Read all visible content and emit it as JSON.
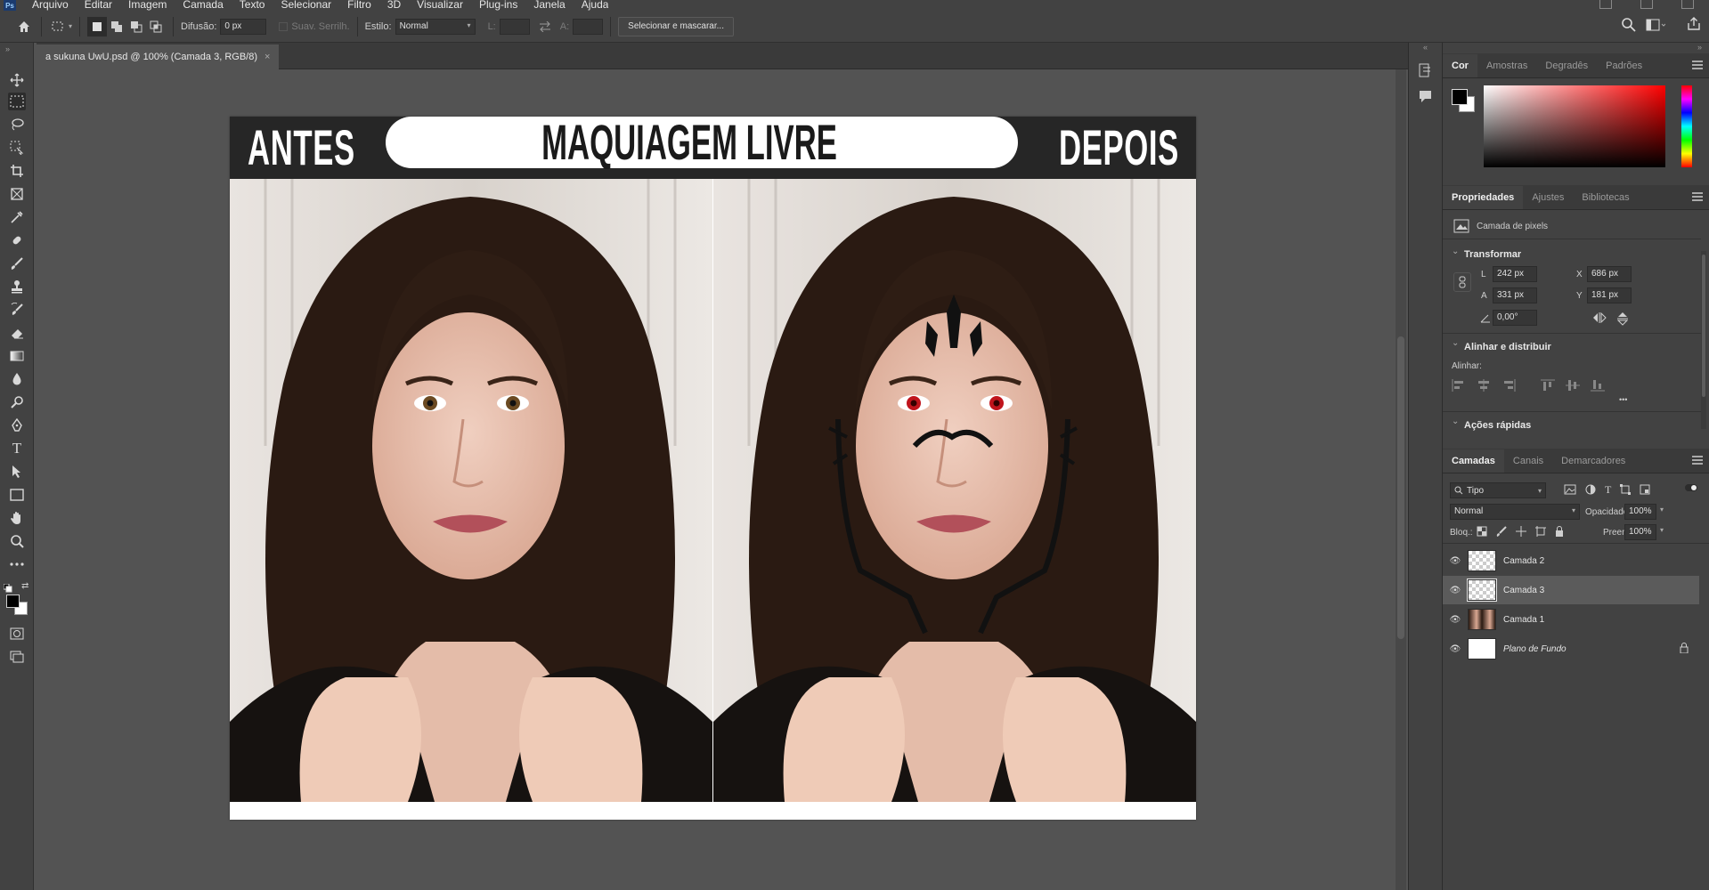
{
  "app": {
    "logo_text": "Ps"
  },
  "menu": [
    "Arquivo",
    "Editar",
    "Imagem",
    "Camada",
    "Texto",
    "Selecionar",
    "Filtro",
    "3D",
    "Visualizar",
    "Plug-ins",
    "Janela",
    "Ajuda"
  ],
  "options_bar": {
    "feather_label": "Difusão:",
    "feather_value": "0 px",
    "anti_alias_label": "Suav. Serrilh.",
    "style_label": "Estilo:",
    "style_value": "Normal",
    "width_label": "L:",
    "height_label": "A:",
    "select_mask_label": "Selecionar e mascarar..."
  },
  "document": {
    "tab_title": "a sukuna UwU.psd @ 100% (Camada 3, RGB/8)",
    "close_glyph": "×"
  },
  "artwork": {
    "left_label": "ANTES",
    "center_label": "MAQUIAGEM LIVRE",
    "right_label": "DEPOIS"
  },
  "color_panel": {
    "tabs": [
      "Cor",
      "Amostras",
      "Degradês",
      "Padrões"
    ],
    "active_tab": "Cor",
    "hue_color": "#ff0000"
  },
  "properties_panel": {
    "tabs": [
      "Propriedades",
      "Ajustes",
      "Bibliotecas"
    ],
    "layer_kind": "Camada de pixels",
    "transform_title": "Transformar",
    "w_label": "L",
    "w_value": "242 px",
    "h_label": "A",
    "h_value": "331 px",
    "x_label": "X",
    "x_value": "686 px",
    "y_label": "Y",
    "y_value": "181 px",
    "angle_value": "0,00°",
    "align_title": "Alinhar e distribuir",
    "align_label": "Alinhar:",
    "quick_actions_title": "Ações rápidas",
    "more_glyph": "•••"
  },
  "layers_panel": {
    "tabs": [
      "Camadas",
      "Canais",
      "Demarcadores"
    ],
    "filter_value": "Tipo",
    "blend_mode": "Normal",
    "opacity_label": "Opacidade:",
    "opacity_value": "100%",
    "lock_label": "Bloq.:",
    "fill_label": "Preen.:",
    "fill_value": "100%",
    "layers": [
      {
        "name": "Camada 2",
        "selected": false,
        "thumb": "checker"
      },
      {
        "name": "Camada 3",
        "selected": true,
        "thumb": "checker"
      },
      {
        "name": "Camada 1",
        "selected": false,
        "thumb": "photo"
      },
      {
        "name": "Plano de Fundo",
        "selected": false,
        "thumb": "white",
        "locked": true
      }
    ]
  }
}
